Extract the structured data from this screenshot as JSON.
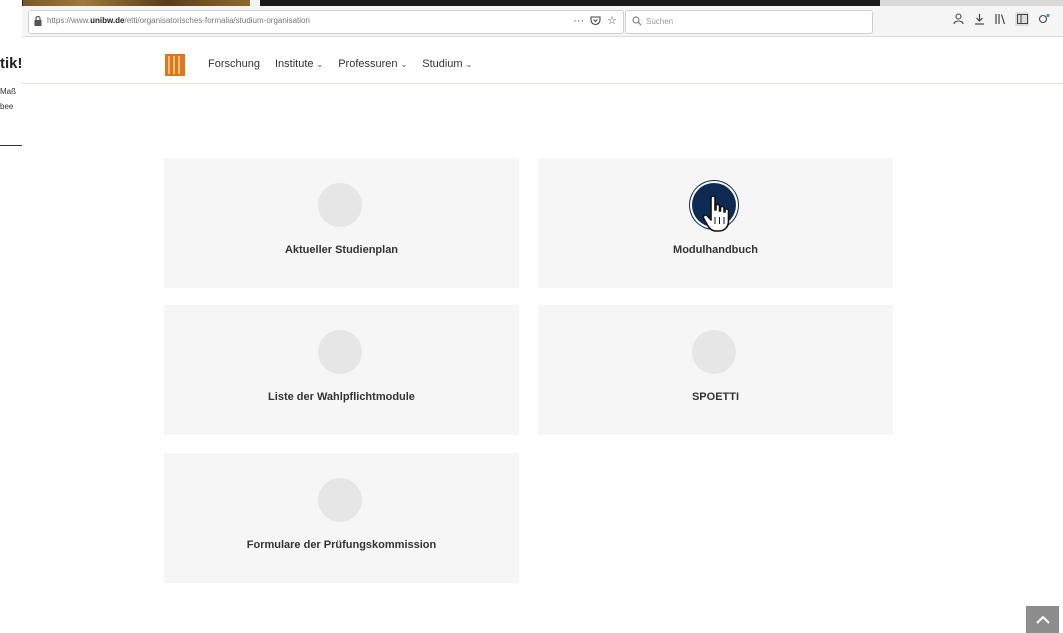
{
  "background_window": {
    "heading_fragment": "tik!",
    "text_line1_fragment": "Maß",
    "text_line2_fragment": "bee"
  },
  "browser": {
    "left_edge_fragment": "0",
    "url_prefix": "https://www.",
    "url_domain": "unibw.de",
    "url_path": "/etti/organisatorisches-formalia/studium-organisation",
    "page_actions": [
      "···",
      "☆"
    ],
    "search_placeholder": "Suchen"
  },
  "site_nav": {
    "items": [
      {
        "label": "Forschung",
        "has_dropdown": false
      },
      {
        "label": "Institute",
        "has_dropdown": true
      },
      {
        "label": "Professuren",
        "has_dropdown": true
      },
      {
        "label": "Studium",
        "has_dropdown": true
      }
    ]
  },
  "tiles": [
    {
      "label": "Aktueller Studienplan",
      "active": false
    },
    {
      "label": "Modulhandbuch",
      "active": true
    },
    {
      "label": "Liste der Wahlpflichtmodule",
      "active": false
    },
    {
      "label": "SPOETTI",
      "active": false
    },
    {
      "label": "Formulare der Prüfungskommission",
      "active": false
    }
  ],
  "colors": {
    "logo": "#e0761c",
    "active_circle": "#0d2b52",
    "tile_bg": "#f6f6f6",
    "scroll_top_bg": "#8d8d8d"
  }
}
